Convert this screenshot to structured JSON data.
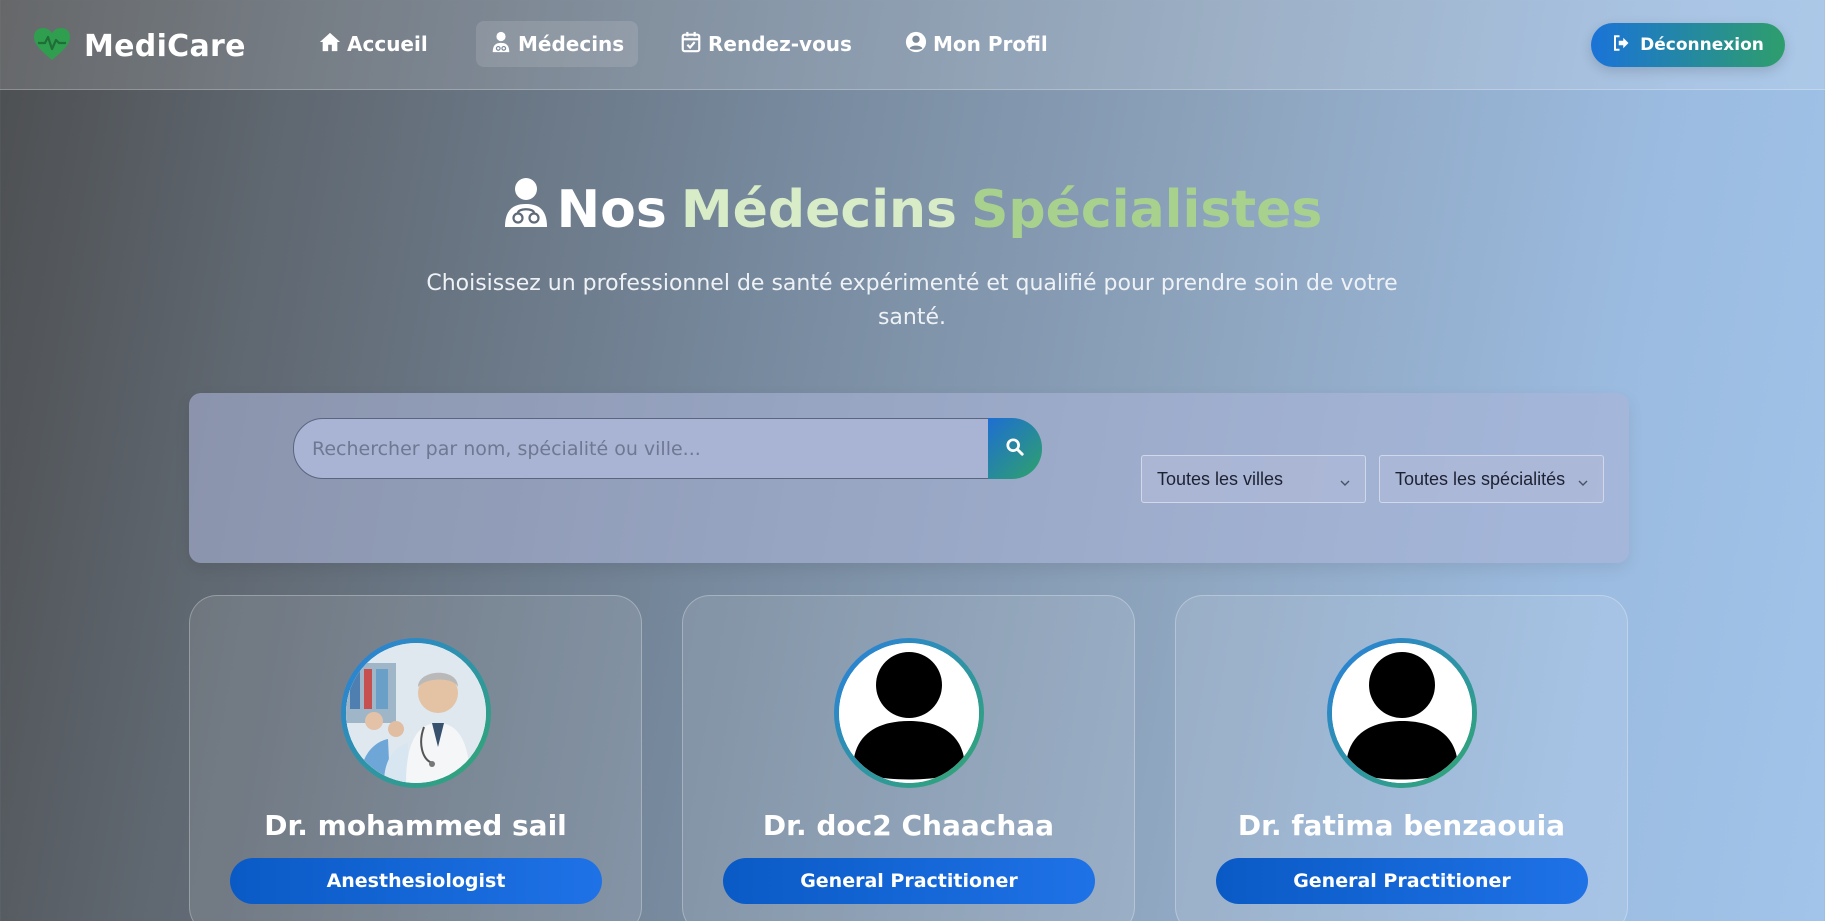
{
  "brand": {
    "name": "MediCare",
    "icon": "heart-pulse-icon",
    "icon_color": "#2f9e4f"
  },
  "nav": {
    "items": [
      {
        "label": "Accueil",
        "icon": "home-icon"
      },
      {
        "label": "Médecins",
        "icon": "doctor-icon",
        "active": true
      },
      {
        "label": "Rendez-vous",
        "icon": "calendar-check-icon"
      },
      {
        "label": "Mon Profil",
        "icon": "user-circle-icon"
      }
    ],
    "logout_label": "Déconnexion"
  },
  "hero": {
    "title_part1": "Nos",
    "title_part2": "Médecins",
    "title_part3": "Spécialistes",
    "subtitle": "Choisissez un professionnel de santé expérimenté et qualifié pour prendre soin de votre santé."
  },
  "search": {
    "placeholder": "Rechercher par nom, spécialité ou ville...",
    "city_filter": "Toutes les villes",
    "specialty_filter": "Toutes les spécialités"
  },
  "doctors": [
    {
      "name": "Dr. mohammed sail",
      "specialty": "Anesthesiologist",
      "avatar": "photo"
    },
    {
      "name": "Dr. doc2 Chaachaa",
      "specialty": "General Practitioner",
      "avatar": "default"
    },
    {
      "name": "Dr. fatima benzaouia",
      "specialty": "General Practitioner",
      "avatar": "default"
    }
  ],
  "colors": {
    "accent_green": "#a9d18e",
    "button_blue": "#1565d8",
    "gradient_green": "#2fa26a"
  }
}
